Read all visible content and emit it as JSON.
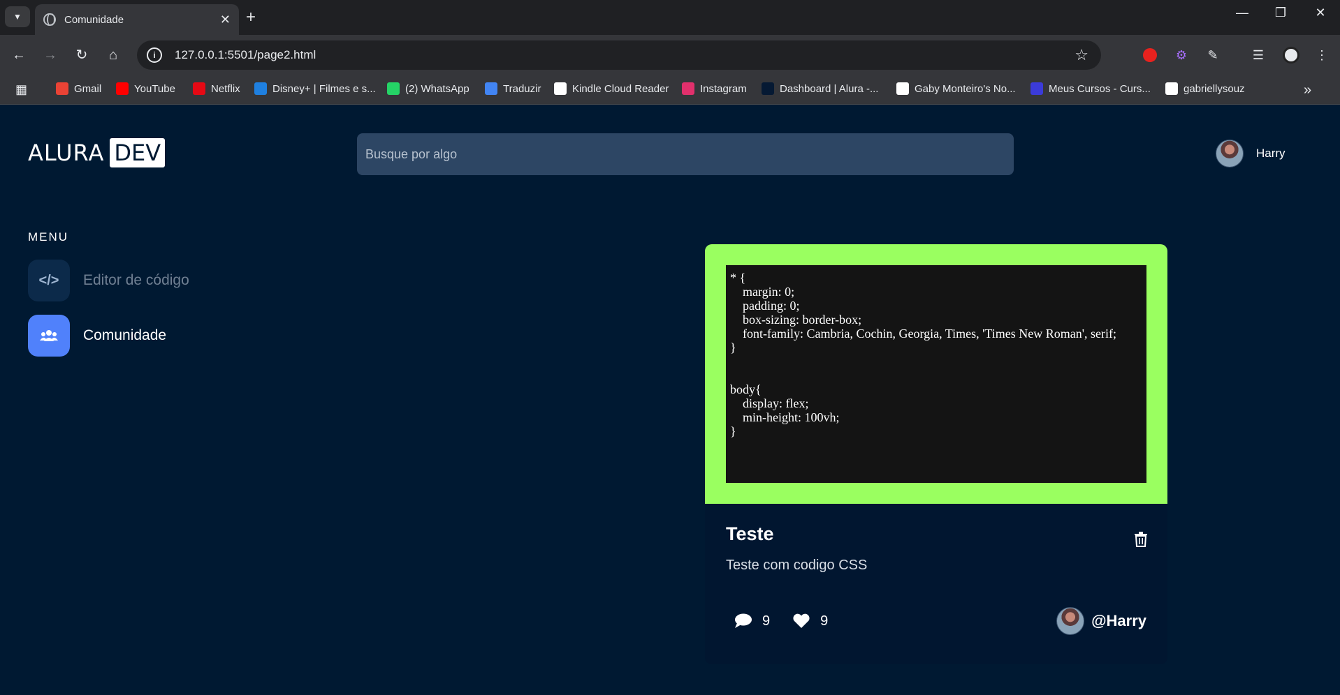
{
  "browser": {
    "tab_title": "Comunidade",
    "url": "127.0.0.1:5501/page2.html",
    "bookmarks": [
      {
        "label": "Gmail",
        "icon": "gmail-icon",
        "color": "#ea4335"
      },
      {
        "label": "YouTube",
        "icon": "youtube-icon",
        "color": "#ff0000"
      },
      {
        "label": "Netflix",
        "icon": "netflix-icon",
        "color": "#e50914"
      },
      {
        "label": "Disney+ | Filmes e s...",
        "icon": "disney-icon",
        "color": "#1f80e0"
      },
      {
        "label": "(2) WhatsApp",
        "icon": "whatsapp-icon",
        "color": "#25d366"
      },
      {
        "label": "Traduzir",
        "icon": "translate-icon",
        "color": "#4285f4"
      },
      {
        "label": "Kindle Cloud Reader",
        "icon": "kindle-icon",
        "color": "#ffffff"
      },
      {
        "label": "Instagram",
        "icon": "instagram-icon",
        "color": "#e1306c"
      },
      {
        "label": "Dashboard | Alura -...",
        "icon": "alura-icon",
        "color": "#051933"
      },
      {
        "label": "Gaby Monteiro's No...",
        "icon": "notion-icon",
        "color": "#ffffff"
      },
      {
        "label": "Meus Cursos - Curs...",
        "icon": "course-icon",
        "color": "#3b3bd9"
      },
      {
        "label": "gabriellysouz",
        "icon": "github-icon",
        "color": "#ffffff"
      }
    ]
  },
  "header": {
    "logo_left": "ALURA",
    "logo_right": "DEV",
    "search_placeholder": "Busque por algo",
    "user_name": "Harry"
  },
  "menu": {
    "title": "MENU",
    "items": [
      {
        "label": "Editor de código",
        "icon": "code-icon",
        "active": false
      },
      {
        "label": "Comunidade",
        "icon": "users-icon",
        "active": true
      }
    ]
  },
  "card": {
    "border_color": "#9aff60",
    "code": "* {\n    margin: 0;\n    padding: 0;\n    box-sizing: border-box;\n    font-family: Cambria, Cochin, Georgia, Times, 'Times New Roman', serif;\n}\n\n\nbody{\n    display: flex;\n    min-height: 100vh;\n}",
    "title": "Teste",
    "description": "Teste com codigo CSS",
    "comments": "9",
    "likes": "9",
    "author": "@Harry"
  },
  "colors": {
    "page_bg": "#001932",
    "search_bg": "#2d4664",
    "accent_blue": "#5081fb",
    "inactive_icon_bg": "#0c2a4a"
  }
}
